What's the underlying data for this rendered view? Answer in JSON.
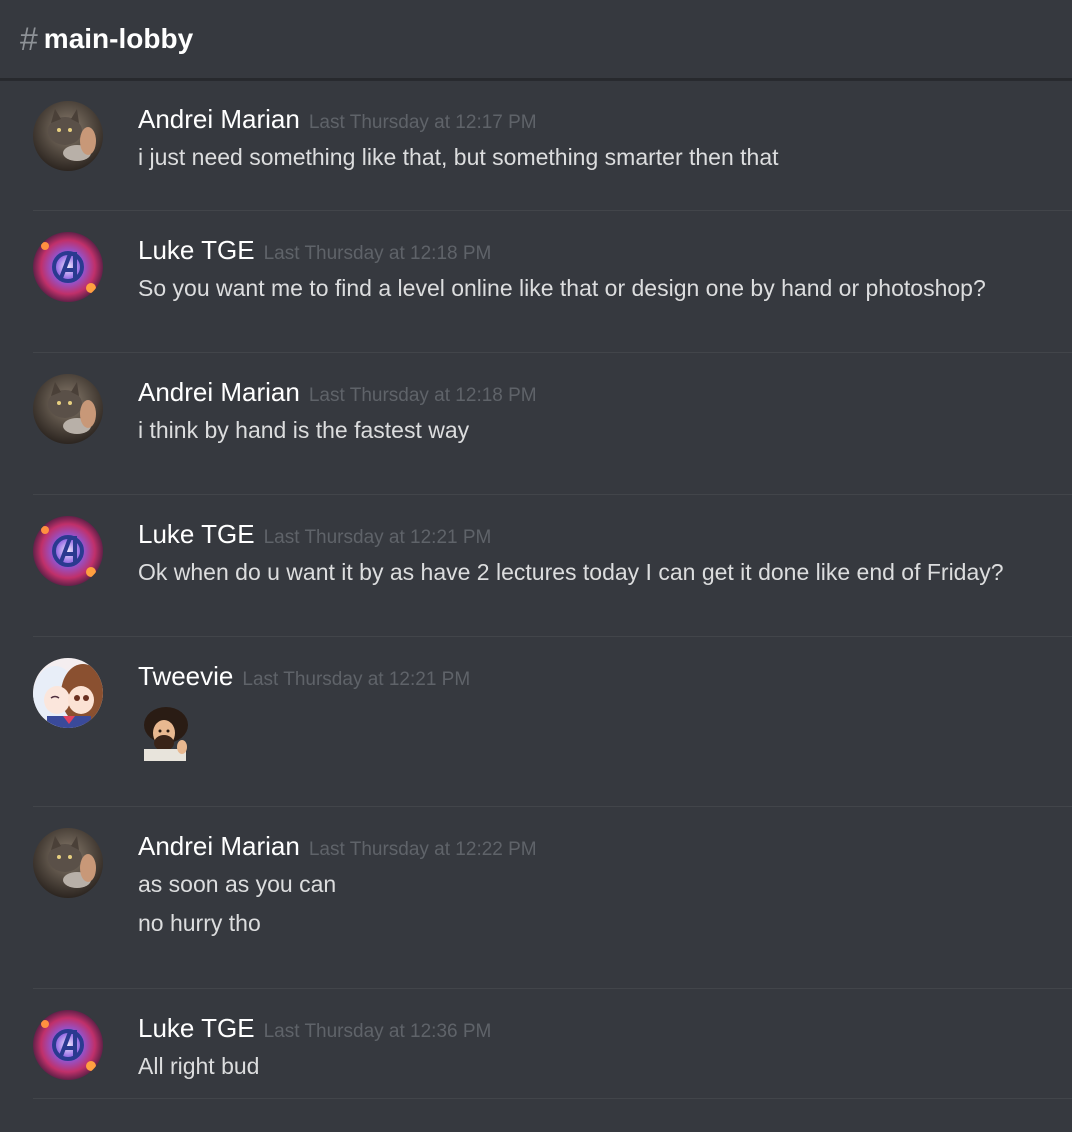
{
  "channel": {
    "hash": "#",
    "name": "main-lobby"
  },
  "messages": [
    {
      "author": "Andrei Marian",
      "timestamp": "Last Thursday at 12:17 PM",
      "avatar": "cat-avatar",
      "lines": [
        "i just need something like that, but something smarter then that"
      ]
    },
    {
      "author": "Luke TGE",
      "timestamp": "Last Thursday at 12:18 PM",
      "avatar": "avengers-avatar",
      "lines": [
        "So you want me to find a level online like that or design one by hand or photoshop?"
      ]
    },
    {
      "author": "Andrei Marian",
      "timestamp": "Last Thursday at 12:18 PM",
      "avatar": "cat-avatar",
      "lines": [
        "i think by hand is the fastest way"
      ]
    },
    {
      "author": "Luke TGE",
      "timestamp": "Last Thursday at 12:21 PM",
      "avatar": "avengers-avatar",
      "lines": [
        "Ok when do u want it by as have 2 lectures today I can get it done like end of Friday?"
      ]
    },
    {
      "author": "Tweevie",
      "timestamp": "Last Thursday at 12:21 PM",
      "avatar": "anime-avatar",
      "emoji": "bob-ross-emoji",
      "lines": []
    },
    {
      "author": "Andrei Marian",
      "timestamp": "Last Thursday at 12:22 PM",
      "avatar": "cat-avatar",
      "lines": [
        "as soon as you can",
        "no hurry tho"
      ]
    },
    {
      "author": "Luke TGE",
      "timestamp": "Last Thursday at 12:36 PM",
      "avatar": "avengers-avatar",
      "lines": [
        "All right bud"
      ]
    }
  ]
}
